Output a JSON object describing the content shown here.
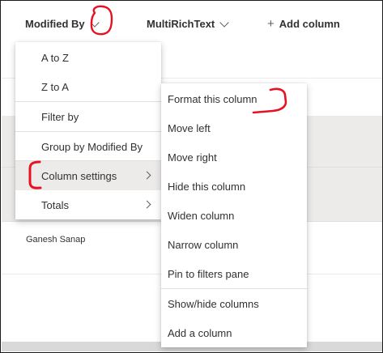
{
  "header": {
    "columns": [
      {
        "label": "Modified By"
      },
      {
        "label": "MultiRichText"
      }
    ],
    "add_column_label": "Add column"
  },
  "list": {
    "rows": [
      {
        "modified_by": ""
      },
      {
        "modified_by": ""
      },
      {
        "modified_by": ""
      },
      {
        "modified_by": "Ganesh Sanap"
      }
    ]
  },
  "column_menu": {
    "items": [
      {
        "label": "A to Z"
      },
      {
        "label": "Z to A"
      },
      {
        "label": "Filter by"
      },
      {
        "label": "Group by Modified By"
      },
      {
        "label": "Column settings"
      },
      {
        "label": "Totals"
      }
    ]
  },
  "column_settings_menu": {
    "items": [
      {
        "label": "Format this column"
      },
      {
        "label": "Move left"
      },
      {
        "label": "Move right"
      },
      {
        "label": "Hide this column"
      },
      {
        "label": "Widen column"
      },
      {
        "label": "Narrow column"
      },
      {
        "label": "Pin to filters pane"
      },
      {
        "label": "Show/hide columns"
      },
      {
        "label": "Add a column"
      }
    ]
  },
  "icons": {
    "column_dropdown": "chevron-down-icon",
    "add": "plus-icon",
    "submenu": "chevron-right-icon"
  },
  "colors": {
    "annotation": "#e81123",
    "selected_row": "#edebe9",
    "text": "#323130"
  }
}
